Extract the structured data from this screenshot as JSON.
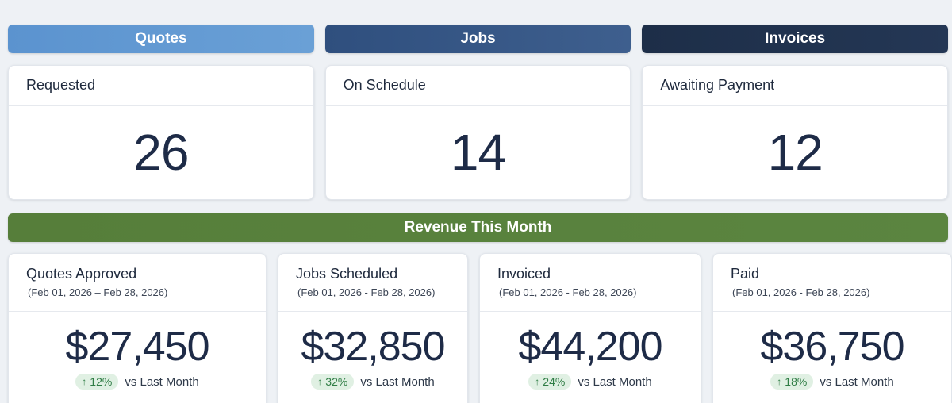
{
  "sections": {
    "quotes": "Quotes",
    "jobs": "Jobs",
    "invoices": "Invoices",
    "revenue": "Revenue This Month"
  },
  "counts": [
    {
      "label": "Requested",
      "value": "26"
    },
    {
      "label": "On Schedule",
      "value": "14"
    },
    {
      "label": "Awaiting Payment",
      "value": "12"
    }
  ],
  "revenue": [
    {
      "title": "Quotes Approved",
      "range": "(Feb 01, 2026 – Feb  28, 2026)",
      "amount": "$27,450",
      "change": "12%",
      "vs": "vs Last Month"
    },
    {
      "title": "Jobs Scheduled",
      "range": "(Feb 01, 2026 - Feb 28, 2026)",
      "amount": "$32,850",
      "change": "32%",
      "vs": "vs Last Month"
    },
    {
      "title": "Invoiced",
      "range": "(Feb 01, 2026 - Feb 28, 2026)",
      "amount": "$44,200",
      "change": "24%",
      "vs": "vs Last Month"
    },
    {
      "title": "Paid",
      "range": "(Feb 01, 2026 - Feb 28, 2026)",
      "amount": "$36,750",
      "change": "18%",
      "vs": "vs Last Month"
    }
  ],
  "icons": {
    "trend": "arrow-up-icon"
  },
  "colors": {
    "quotes": "#5b93cf",
    "jobs": "#2f4f7e",
    "invoices": "#1d2e48",
    "revenue": "#567e3a",
    "positive": "#2f7d45"
  }
}
